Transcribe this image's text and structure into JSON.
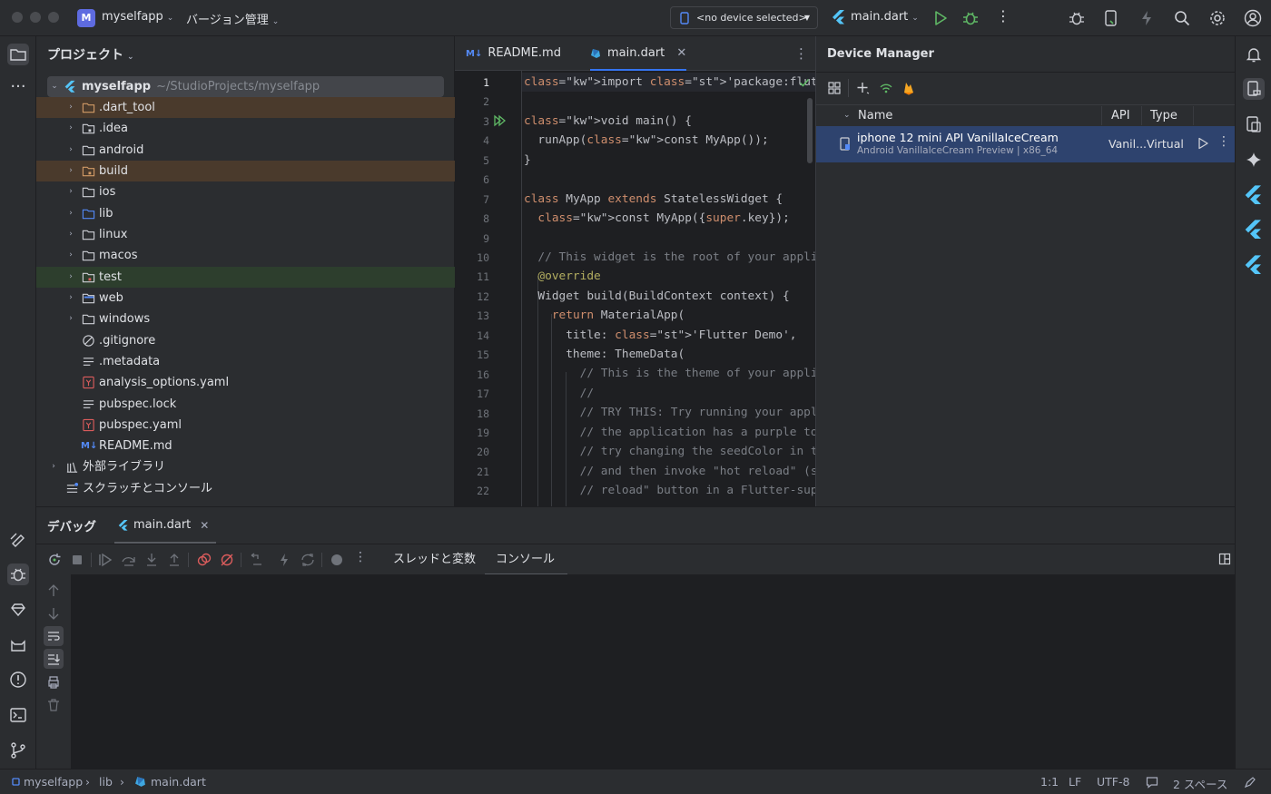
{
  "titlebar": {
    "project_badge": "M",
    "project_name": "myselfapp",
    "vcs_menu": "バージョン管理",
    "device_selector": "<no device selected>",
    "run_config": "main.dart"
  },
  "project_panel": {
    "title": "プロジェクト",
    "root_name": "myselfapp",
    "root_path": "~/StudioProjects/myselfapp",
    "items": [
      {
        "label": ".dart_tool"
      },
      {
        "label": ".idea"
      },
      {
        "label": "android"
      },
      {
        "label": "build"
      },
      {
        "label": "ios"
      },
      {
        "label": "lib"
      },
      {
        "label": "linux"
      },
      {
        "label": "macos"
      },
      {
        "label": "test"
      },
      {
        "label": "web"
      },
      {
        "label": "windows"
      },
      {
        "label": ".gitignore"
      },
      {
        "label": ".metadata"
      },
      {
        "label": "analysis_options.yaml"
      },
      {
        "label": "pubspec.lock"
      },
      {
        "label": "pubspec.yaml"
      },
      {
        "label": "README.md"
      }
    ],
    "external_libs": "外部ライブラリ",
    "scratches": "スクラッチとコンソール"
  },
  "editor": {
    "tabs": [
      {
        "label": "README.md",
        "icon_text": "M↓"
      },
      {
        "label": "main.dart"
      }
    ],
    "line_numbers": [
      "1",
      "2",
      "3",
      "4",
      "5",
      "6",
      "7",
      "8",
      "9",
      "10",
      "11",
      "12",
      "13",
      "14",
      "15",
      "16",
      "17",
      "18",
      "19",
      "20",
      "21",
      "22"
    ],
    "code_lines": [
      "import 'package:flutter/material.dart';",
      "",
      "void main() {",
      "  runApp(const MyApp());",
      "}",
      "",
      "class MyApp extends StatelessWidget {",
      "  const MyApp({super.key});",
      "",
      "  // This widget is the root of your applic",
      "  @override",
      "  Widget build(BuildContext context) {",
      "    return MaterialApp(",
      "      title: 'Flutter Demo',",
      "      theme: ThemeData(",
      "        // This is the theme of your applic",
      "        //",
      "        // TRY THIS: Try running your appli",
      "        // the application has a purple too",
      "        // try changing the seedColor in th",
      "        // and then invoke \"hot reload\" (sa",
      "        // reload\" button in a Flutter-supp"
    ]
  },
  "device_manager": {
    "title": "Device Manager",
    "columns": {
      "name": "Name",
      "api": "API",
      "type": "Type"
    },
    "device": {
      "name": "iphone 12 mini API VanillaIceCream",
      "detail": "Android VanillaIceCream Preview | x86_64",
      "api": "Vanil...",
      "type": "Virtual"
    }
  },
  "debug_panel": {
    "title": "デバッグ",
    "session_tab": "main.dart",
    "subtabs": [
      "スレッドと変数",
      "コンソール"
    ],
    "active_subtab": "コンソール"
  },
  "statusbar": {
    "breadcrumb": [
      "myselfapp",
      "lib",
      "main.dart"
    ],
    "position": "1:1",
    "line_ending": "LF",
    "encoding": "UTF-8",
    "indent": "2 スペース"
  },
  "colors": {
    "accent": "#3574f0",
    "panel_bg": "#2b2d30",
    "editor_bg": "#1e1f22",
    "selection": "#2e436e",
    "flutter_blue": "#54c5f8",
    "run_green": "#5fb865"
  }
}
